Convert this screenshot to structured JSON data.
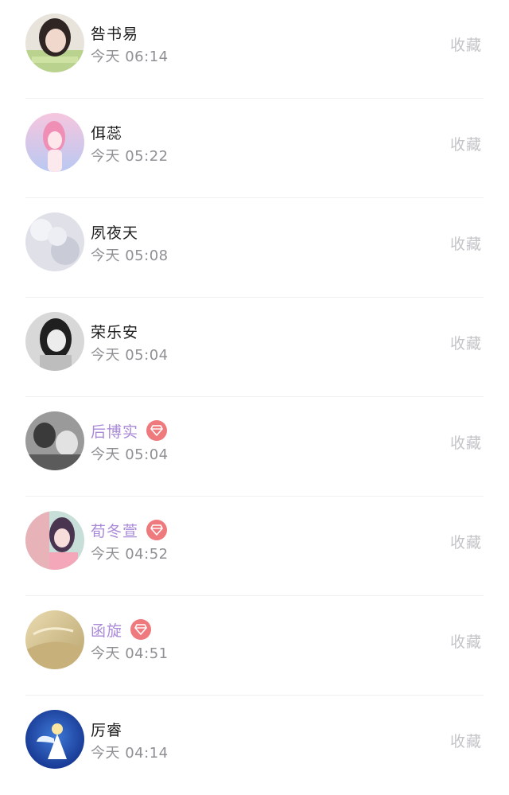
{
  "items": [
    {
      "name": "咎书易",
      "time": "今天 06:14",
      "action": "收藏",
      "vip": false
    },
    {
      "name": "佴蕊",
      "time": "今天 05:22",
      "action": "收藏",
      "vip": false
    },
    {
      "name": "夙夜天",
      "time": "今天 05:08",
      "action": "收藏",
      "vip": false
    },
    {
      "name": "荣乐安",
      "time": "今天 05:04",
      "action": "收藏",
      "vip": false
    },
    {
      "name": "后博实",
      "time": "今天 05:04",
      "action": "收藏",
      "vip": true
    },
    {
      "name": "荀冬萱",
      "time": "今天 04:52",
      "action": "收藏",
      "vip": true
    },
    {
      "name": "函旋",
      "time": "今天 04:51",
      "action": "收藏",
      "vip": true
    },
    {
      "name": "厉睿",
      "time": "今天 04:14",
      "action": "收藏",
      "vip": false
    }
  ],
  "colors": {
    "vip_name": "#a98ad6",
    "vip_badge": "#ef7a7d",
    "name": "#1c1c1c",
    "time": "#8f8f94",
    "action": "#c4c4c8"
  },
  "icons": {
    "vip_badge": "diamond-icon"
  }
}
